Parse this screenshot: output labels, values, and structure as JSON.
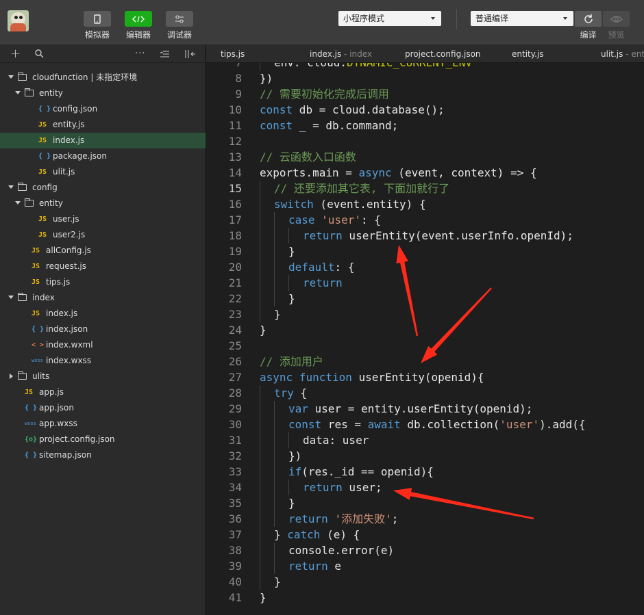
{
  "toolbar": {
    "simulator_label": "模拟器",
    "editor_label": "编辑器",
    "debugger_label": "调试器",
    "mode_select": "小程序模式",
    "compile_select": "普通编译",
    "compile_label": "编译",
    "preview_label": "预览"
  },
  "sidebar": {
    "tree": [
      {
        "label": "cloudfunction | 未指定环境",
        "kind": "cloud-folder",
        "depth": 0,
        "expanded": true
      },
      {
        "label": "entity",
        "kind": "folder",
        "depth": 1,
        "expanded": true
      },
      {
        "label": "config.json",
        "kind": "json",
        "depth": 2
      },
      {
        "label": "entity.js",
        "kind": "js",
        "depth": 2
      },
      {
        "label": "index.js",
        "kind": "js",
        "depth": 2,
        "selected": true
      },
      {
        "label": "package.json",
        "kind": "json",
        "depth": 2
      },
      {
        "label": "ulit.js",
        "kind": "js",
        "depth": 2
      },
      {
        "label": "config",
        "kind": "folder",
        "depth": 0,
        "expanded": true
      },
      {
        "label": "entity",
        "kind": "folder",
        "depth": 1,
        "expanded": true
      },
      {
        "label": "user.js",
        "kind": "js",
        "depth": 2
      },
      {
        "label": "user2.js",
        "kind": "js",
        "depth": 2
      },
      {
        "label": "allConfig.js",
        "kind": "js",
        "depth": 1
      },
      {
        "label": "request.js",
        "kind": "js",
        "depth": 1
      },
      {
        "label": "tips.js",
        "kind": "js",
        "depth": 1
      },
      {
        "label": "index",
        "kind": "folder",
        "depth": 0,
        "expanded": true
      },
      {
        "label": "index.js",
        "kind": "js",
        "depth": 1
      },
      {
        "label": "index.json",
        "kind": "json",
        "depth": 1
      },
      {
        "label": "index.wxml",
        "kind": "wxml",
        "depth": 1
      },
      {
        "label": "index.wxss",
        "kind": "wxss",
        "depth": 1
      },
      {
        "label": "ulits",
        "kind": "folder",
        "depth": 0,
        "expanded": false
      },
      {
        "label": "app.js",
        "kind": "js",
        "depth": 0
      },
      {
        "label": "app.json",
        "kind": "json",
        "depth": 0
      },
      {
        "label": "app.wxss",
        "kind": "wxss",
        "depth": 0
      },
      {
        "label": "project.config.json",
        "kind": "proj",
        "depth": 0
      },
      {
        "label": "sitemap.json",
        "kind": "json",
        "depth": 0
      }
    ]
  },
  "tabs": [
    {
      "label": "tips.js",
      "sub": ""
    },
    {
      "label": "index.js",
      "sub": " - index"
    },
    {
      "label": "project.config.json",
      "sub": ""
    },
    {
      "label": "entity.js",
      "sub": ""
    },
    {
      "label": "ulit.js",
      "sub": " - entity"
    }
  ],
  "editor": {
    "current_line": 15,
    "lines": [
      {
        "n": "7",
        "indent": 1,
        "parts": [
          [
            "",
            "env: cloud."
          ],
          [
            "gold",
            "DYNAMIC_CURRENT_ENV"
          ]
        ]
      },
      {
        "n": "8",
        "indent": 0,
        "parts": [
          [
            "",
            "})"
          ]
        ]
      },
      {
        "n": "9",
        "indent": 0,
        "parts": [
          [
            "cm",
            "// 需要初始化完成后调用"
          ]
        ]
      },
      {
        "n": "10",
        "indent": 0,
        "parts": [
          [
            "kw",
            "const"
          ],
          [
            "",
            " db = cloud.database();"
          ]
        ]
      },
      {
        "n": "11",
        "indent": 0,
        "parts": [
          [
            "kw",
            "const"
          ],
          [
            "",
            " _ = db.command;"
          ]
        ]
      },
      {
        "n": "12",
        "indent": 0,
        "parts": []
      },
      {
        "n": "13",
        "indent": 0,
        "parts": [
          [
            "cm",
            "// 云函数入口函数"
          ]
        ]
      },
      {
        "n": "14",
        "indent": 0,
        "parts": [
          [
            "",
            "exports.main = "
          ],
          [
            "kw",
            "async"
          ],
          [
            "",
            " (event, context) => {"
          ]
        ]
      },
      {
        "n": "15",
        "indent": 1,
        "parts": [
          [
            "cm",
            "// 还要添加其它表, 下面加就行了"
          ]
        ]
      },
      {
        "n": "16",
        "indent": 1,
        "parts": [
          [
            "kw",
            "switch"
          ],
          [
            "",
            " (event.entity) {"
          ]
        ]
      },
      {
        "n": "17",
        "indent": 2,
        "parts": [
          [
            "kw",
            "case"
          ],
          [
            "",
            " "
          ],
          [
            "str",
            "'user'"
          ],
          [
            "",
            ": {"
          ]
        ]
      },
      {
        "n": "18",
        "indent": 3,
        "parts": [
          [
            "kw",
            "return"
          ],
          [
            "",
            " userEntity(event.userInfo.openId);"
          ]
        ]
      },
      {
        "n": "19",
        "indent": 2,
        "parts": [
          [
            "",
            "}"
          ]
        ]
      },
      {
        "n": "20",
        "indent": 2,
        "parts": [
          [
            "kw",
            "default"
          ],
          [
            "",
            ": {"
          ]
        ]
      },
      {
        "n": "21",
        "indent": 3,
        "parts": [
          [
            "kw",
            "return"
          ]
        ]
      },
      {
        "n": "22",
        "indent": 2,
        "parts": [
          [
            "",
            "}"
          ]
        ]
      },
      {
        "n": "23",
        "indent": 1,
        "parts": [
          [
            "",
            "}"
          ]
        ]
      },
      {
        "n": "24",
        "indent": 0,
        "parts": [
          [
            "",
            "}"
          ]
        ]
      },
      {
        "n": "25",
        "indent": 0,
        "parts": []
      },
      {
        "n": "26",
        "indent": 0,
        "parts": [
          [
            "cm",
            "// 添加用户"
          ]
        ]
      },
      {
        "n": "27",
        "indent": 0,
        "parts": [
          [
            "kw",
            "async"
          ],
          [
            "",
            " "
          ],
          [
            "kw",
            "function"
          ],
          [
            "",
            " userEntity(openid){"
          ]
        ]
      },
      {
        "n": "28",
        "indent": 1,
        "parts": [
          [
            "kw",
            "try"
          ],
          [
            "",
            " {"
          ]
        ]
      },
      {
        "n": "29",
        "indent": 2,
        "parts": [
          [
            "kw",
            "var"
          ],
          [
            "",
            " user = entity.userEntity(openid);"
          ]
        ]
      },
      {
        "n": "30",
        "indent": 2,
        "parts": [
          [
            "kw",
            "const"
          ],
          [
            "",
            " res = "
          ],
          [
            "kw",
            "await"
          ],
          [
            "",
            " db.collection("
          ],
          [
            "str",
            "'user'"
          ],
          [
            "",
            ").add({"
          ]
        ]
      },
      {
        "n": "31",
        "indent": 3,
        "parts": [
          [
            "",
            "data: user"
          ]
        ]
      },
      {
        "n": "32",
        "indent": 2,
        "parts": [
          [
            "",
            "})"
          ]
        ]
      },
      {
        "n": "33",
        "indent": 2,
        "parts": [
          [
            "kw",
            "if"
          ],
          [
            "",
            "(res._id == openid){"
          ]
        ]
      },
      {
        "n": "34",
        "indent": 3,
        "parts": [
          [
            "kw",
            "return"
          ],
          [
            "",
            " user;"
          ]
        ]
      },
      {
        "n": "35",
        "indent": 2,
        "parts": [
          [
            "",
            "}"
          ]
        ]
      },
      {
        "n": "36",
        "indent": 2,
        "parts": [
          [
            "kw",
            "return"
          ],
          [
            "",
            " "
          ],
          [
            "str",
            "'添加失败'"
          ],
          [
            "",
            ";"
          ]
        ]
      },
      {
        "n": "37",
        "indent": 1,
        "parts": [
          [
            "",
            "} "
          ],
          [
            "kw",
            "catch"
          ],
          [
            "",
            " (e) {"
          ]
        ]
      },
      {
        "n": "38",
        "indent": 2,
        "parts": [
          [
            "",
            "console.error(e)"
          ]
        ]
      },
      {
        "n": "39",
        "indent": 2,
        "parts": [
          [
            "kw",
            "return"
          ],
          [
            "",
            " e"
          ]
        ]
      },
      {
        "n": "40",
        "indent": 1,
        "parts": [
          [
            "",
            "}"
          ]
        ]
      },
      {
        "n": "41",
        "indent": 0,
        "parts": [
          [
            "",
            "}"
          ]
        ]
      }
    ]
  },
  "annotations": {
    "arrow_color": "#ff2a1a"
  }
}
